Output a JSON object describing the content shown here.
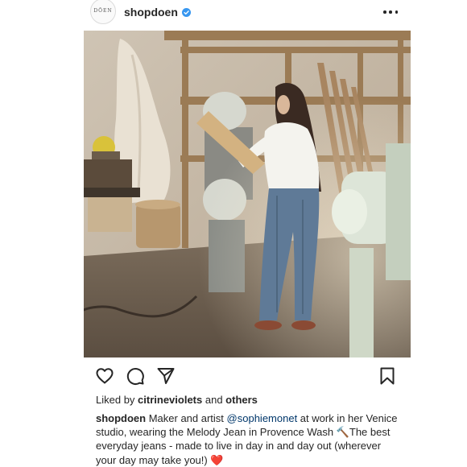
{
  "post": {
    "avatar_text": "DŌEN",
    "username": "shopdoen",
    "verified_icon": "verified-badge-icon",
    "more_icon": "more-options-icon"
  },
  "photo": {
    "alt": "Woman in white shirt and jeans working in a wood shop studio"
  },
  "actions": {
    "icons": [
      "like-heart-icon",
      "comment-icon",
      "share-icon",
      "bookmark-icon"
    ]
  },
  "likes": {
    "prefix": "Liked by ",
    "user": "citrineviolets",
    "middle": " and ",
    "others": "others"
  },
  "caption": {
    "username": "shopdoen",
    "text_1": " Maker and artist ",
    "mention": "@sophiemonet",
    "text_2": " at work in her Venice studio, wearing the Melody Jean in Provence Wash ",
    "hammer": "🔨",
    "text_3": "The best everyday jeans - made to live in day in and day out (wherever your day may take you!) ",
    "heart": "❤️"
  },
  "colors": {
    "text": "#262626",
    "mention": "#00376b",
    "verified": "#3897f0",
    "heart": "#e0103b"
  }
}
